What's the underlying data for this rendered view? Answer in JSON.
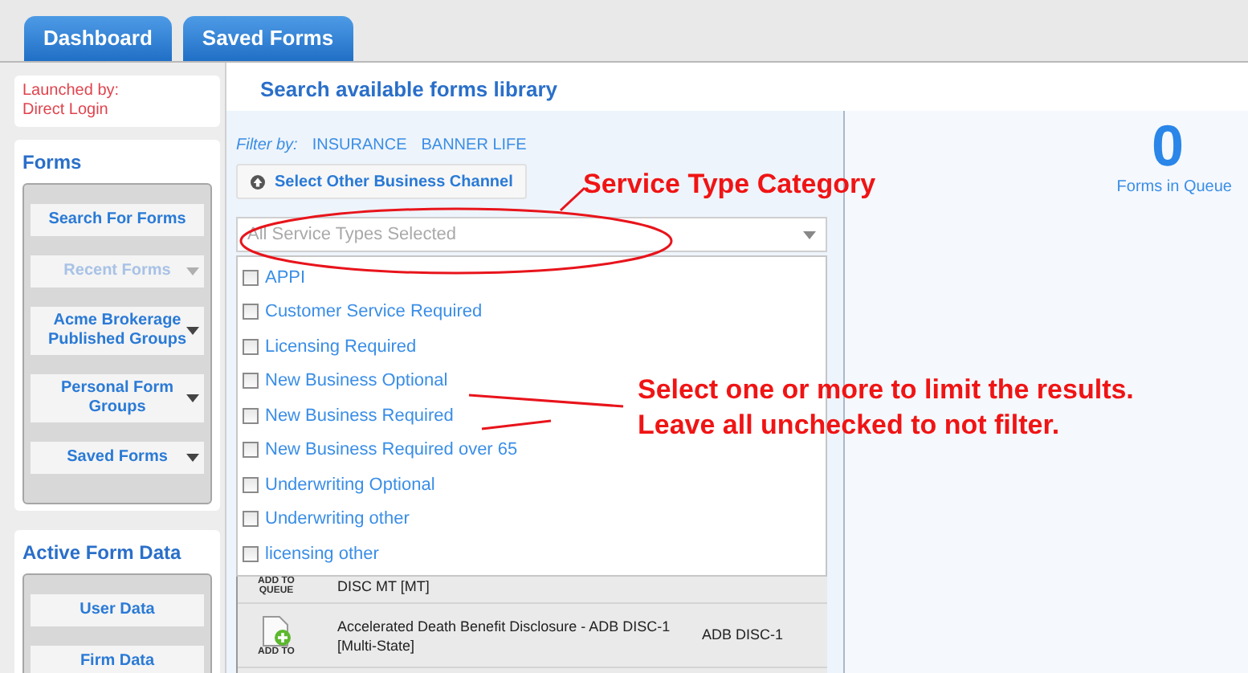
{
  "tabs": [
    {
      "label": "Dashboard"
    },
    {
      "label": "Saved Forms"
    }
  ],
  "sidebar": {
    "launched_by": {
      "label": "Launched by:",
      "value": "Direct Login"
    },
    "forms": {
      "title": "Forms",
      "buttons": [
        {
          "label": "Search For Forms",
          "disabled": false,
          "dropdown": false
        },
        {
          "label": "Recent Forms",
          "disabled": true,
          "dropdown": true
        },
        {
          "label": "Acme Brokerage Published Groups",
          "disabled": false,
          "dropdown": true
        },
        {
          "label": "Personal Form Groups",
          "disabled": false,
          "dropdown": true
        },
        {
          "label": "Saved Forms",
          "disabled": false,
          "dropdown": true
        }
      ]
    },
    "active_form_data": {
      "title": "Active Form Data",
      "buttons": [
        {
          "label": "User Data"
        },
        {
          "label": "Firm Data"
        }
      ]
    }
  },
  "main": {
    "title": "Search available forms library",
    "filter": {
      "label": "Filter by:",
      "values": [
        "INSURANCE",
        "BANNER LIFE"
      ]
    },
    "channel_button": {
      "label": "Select Other Business Channel"
    },
    "service_type_dropdown": {
      "placeholder": "All Service Types Selected",
      "expanded": true,
      "options": [
        {
          "label": "APPI",
          "checked": false
        },
        {
          "label": "Customer Service Required",
          "checked": false
        },
        {
          "label": "Licensing Required",
          "checked": false
        },
        {
          "label": "New Business Optional",
          "checked": false
        },
        {
          "label": "New Business Required",
          "checked": false
        },
        {
          "label": "New Business Required over 65",
          "checked": false
        },
        {
          "label": "Underwriting Optional",
          "checked": false
        },
        {
          "label": "Underwriting other",
          "checked": false
        },
        {
          "label": "licensing other",
          "checked": false
        }
      ]
    },
    "results": [
      {
        "add_label": "ADD TO QUEUE",
        "name": "DISC MT [MT]"
      },
      {
        "add_label": "ADD TO",
        "name": "Accelerated Death Benefit Disclosure - ADB DISC-1 [Multi-State]",
        "code": "ADB DISC-1"
      }
    ],
    "queue": {
      "count": "0",
      "label": "Forms in Queue"
    }
  },
  "annotations": [
    {
      "text": "Service Type Category"
    },
    {
      "text": "Select one or more to limit the results. Leave all unchecked to not filter."
    }
  ]
}
